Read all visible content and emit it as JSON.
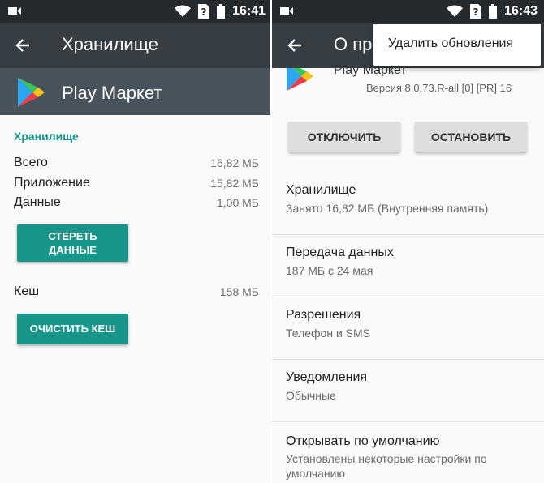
{
  "left": {
    "status": {
      "time": "16:41"
    },
    "appbar": {
      "title": "Хранилище"
    },
    "app": {
      "name": "Play Маркет"
    },
    "storage": {
      "section_title": "Хранилище",
      "rows": [
        {
          "label": "Всего",
          "value": "16,82 МБ"
        },
        {
          "label": "Приложение",
          "value": "15,82 МБ"
        },
        {
          "label": "Данные",
          "value": "1,00 МБ"
        }
      ],
      "clear_data_line1": "СТЕРЕТЬ",
      "clear_data_line2": "ДАННЫЕ"
    },
    "cache": {
      "label": "Кеш",
      "value": "158 МБ",
      "clear_cache_label": "ОЧИСТИТЬ КЕШ"
    }
  },
  "right": {
    "status": {
      "time": "16:43"
    },
    "appbar": {
      "title": "О при"
    },
    "app": {
      "name": "Play Маркет",
      "version": "Версия 8.0.73.R-all [0] [PR] 16"
    },
    "buttons": {
      "disable": "ОТКЛЮЧИТЬ",
      "stop": "ОСТАНОВИТЬ"
    },
    "items": [
      {
        "title": "Хранилище",
        "subtitle": "Занято 16,82 МБ (Внутренняя память)"
      },
      {
        "title": "Передача данных",
        "subtitle": "187 МБ с 24 мая"
      },
      {
        "title": "Разрешения",
        "subtitle": "Телефон и SMS"
      },
      {
        "title": "Уведомления",
        "subtitle": "Обычные"
      },
      {
        "title": "Открывать по умолчанию",
        "subtitle": "Установлены некоторые настройки по умолчанию"
      }
    ],
    "menu": {
      "uninstall_updates": "Удалить обновления"
    }
  },
  "colors": {
    "accent": "#18968a",
    "appbar": "#363d43",
    "statusbar": "#252a2e",
    "header": "#48535b"
  }
}
